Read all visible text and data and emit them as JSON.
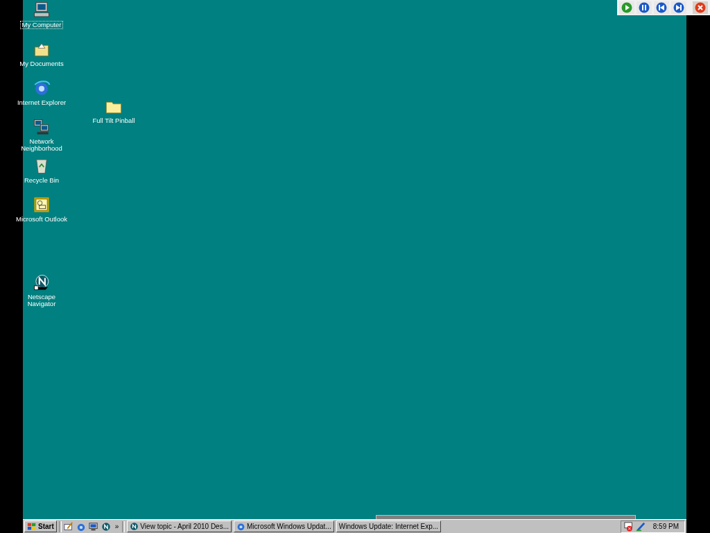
{
  "desktop_icons": [
    {
      "kind": "computer",
      "label": "My Computer",
      "focused": true
    },
    {
      "kind": "documents",
      "label": "My Documents",
      "focused": false
    },
    {
      "kind": "ie",
      "label": "Internet Explorer",
      "focused": false
    },
    {
      "kind": "network",
      "label": "Network Neighborhood",
      "focused": false
    },
    {
      "kind": "recycle",
      "label": "Recycle Bin",
      "focused": false
    },
    {
      "kind": "outlook",
      "label": "Microsoft Outlook",
      "focused": false
    },
    {
      "kind": "netscape",
      "label": "Netscape Navigator",
      "focused": false
    },
    {
      "kind": "folder",
      "label": "Full Tilt Pinball",
      "focused": false
    }
  ],
  "player_controls": [
    {
      "kind": "play"
    },
    {
      "kind": "pause"
    },
    {
      "kind": "previous"
    },
    {
      "kind": "next"
    },
    {
      "kind": "close"
    }
  ],
  "taskbar": {
    "start": "Start",
    "quick_launch": [
      {
        "kind": "outlook_express"
      },
      {
        "kind": "ie"
      },
      {
        "kind": "desktop"
      },
      {
        "kind": "netscape"
      }
    ],
    "chevron": "»",
    "tasks": [
      {
        "kind": "netscape",
        "label": "View topic - April 2010 Des..."
      },
      {
        "kind": "ie",
        "label": "Microsoft Windows Updat..."
      },
      {
        "kind": "none",
        "label": "Windows Update: Internet Exp..."
      }
    ],
    "tray": [
      {
        "kind": "network_error"
      },
      {
        "kind": "pen"
      }
    ],
    "clock": "8:59 PM"
  }
}
